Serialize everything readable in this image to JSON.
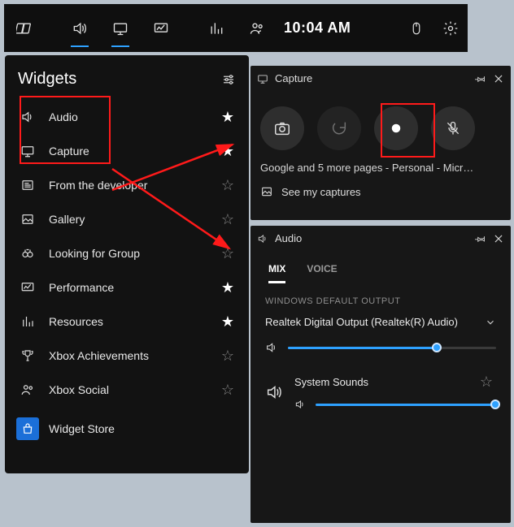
{
  "gamebar": {
    "time": "10:04 AM"
  },
  "widgets": {
    "title": "Widgets",
    "items": [
      {
        "label": "Audio",
        "starred": true
      },
      {
        "label": "Capture",
        "starred": true
      },
      {
        "label": "From the developer",
        "starred": false
      },
      {
        "label": "Gallery",
        "starred": false
      },
      {
        "label": "Looking for Group",
        "starred": false
      },
      {
        "label": "Performance",
        "starred": true
      },
      {
        "label": "Resources",
        "starred": true
      },
      {
        "label": "Xbox Achievements",
        "starred": false
      },
      {
        "label": "Xbox Social",
        "starred": false
      }
    ],
    "store_label": "Widget Store"
  },
  "capture": {
    "title": "Capture",
    "subtitle": "Google and 5 more pages - Personal - Micr…",
    "link": "See my captures"
  },
  "audio": {
    "title": "Audio",
    "tabs": {
      "mix": "MIX",
      "voice": "VOICE"
    },
    "section": "WINDOWS DEFAULT OUTPUT",
    "output_device": "Realtek Digital Output (Realtek(R) Audio)",
    "master_volume_pct": 72,
    "mixer": {
      "name": "System Sounds",
      "volume_pct": 100,
      "starred": false
    }
  }
}
